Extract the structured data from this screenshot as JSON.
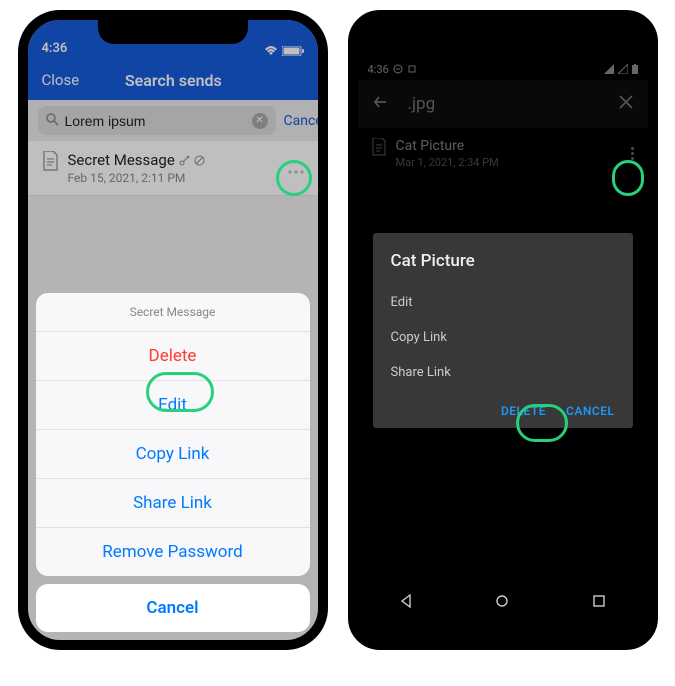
{
  "ios": {
    "statusbar": {
      "time": "4:36"
    },
    "navbar": {
      "close": "Close",
      "title": "Search sends"
    },
    "search": {
      "value": "Lorem ipsum",
      "cancel": "Cancel"
    },
    "item": {
      "title": "Secret Message",
      "subtitle": "Feb 15, 2021, 2:11 PM"
    },
    "sheet": {
      "header": "Secret Message",
      "delete": "Delete",
      "edit": "Edit",
      "copy": "Copy Link",
      "share": "Share Link",
      "remove": "Remove Password",
      "cancel": "Cancel"
    }
  },
  "android": {
    "statusbar": {
      "time": "4:36"
    },
    "appbar": {
      "title": ".jpg"
    },
    "item": {
      "title": "Cat Picture",
      "subtitle": "Mar 1, 2021, 2:34 PM"
    },
    "dialog": {
      "title": "Cat Picture",
      "edit": "Edit",
      "copy": "Copy Link",
      "share": "Share Link",
      "delete": "DELETE",
      "cancel": "CANCEL"
    }
  }
}
